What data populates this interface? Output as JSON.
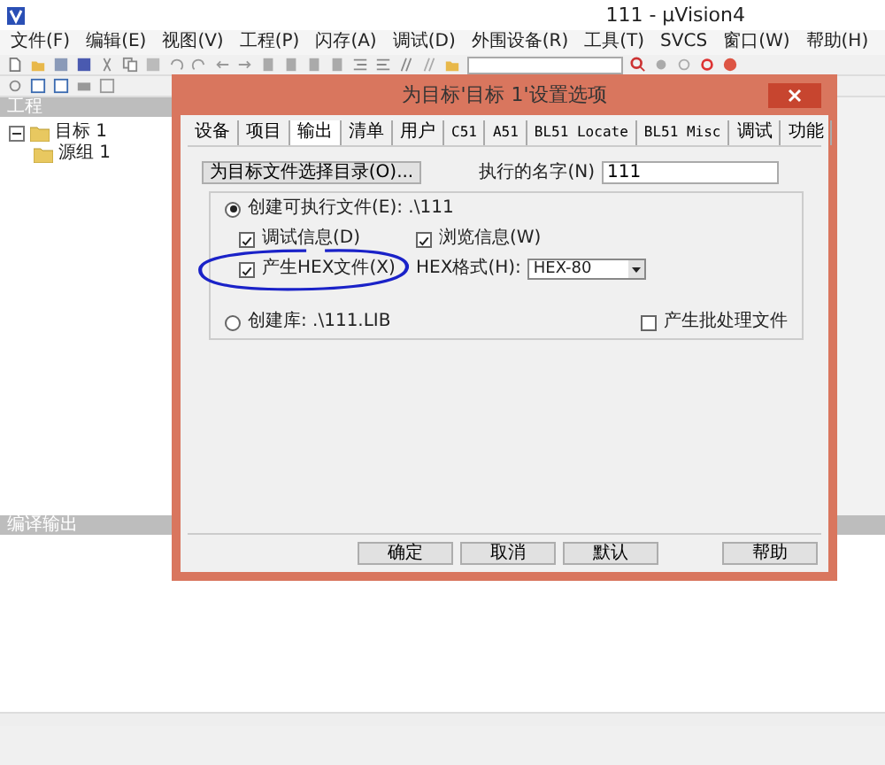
{
  "window": {
    "title": "111  - μVision4"
  },
  "menu": [
    "文件(F)",
    "编辑(E)",
    "视图(V)",
    "工程(P)",
    "闪存(A)",
    "调试(D)",
    "外围设备(R)",
    "工具(T)",
    "SVCS",
    "窗口(W)",
    "帮助(H)"
  ],
  "project_panel": {
    "title": "工程",
    "tree": [
      {
        "label": "目标 1",
        "expanded": true,
        "children": [
          {
            "label": "源组 1"
          }
        ]
      }
    ]
  },
  "output_panel": {
    "title": "编译输出"
  },
  "dialog": {
    "title": "为目标'目标 1'设置选项",
    "tabs": [
      {
        "label": "设备",
        "selected": false
      },
      {
        "label": "项目",
        "selected": false
      },
      {
        "label": "输出",
        "selected": true
      },
      {
        "label": "清单",
        "selected": false
      },
      {
        "label": "用户",
        "selected": false
      },
      {
        "label": "C51",
        "selected": false
      },
      {
        "label": "A51",
        "selected": false
      },
      {
        "label": "BL51 Locate",
        "selected": false
      },
      {
        "label": "BL51 Misc",
        "selected": false
      },
      {
        "label": "调试",
        "selected": false
      },
      {
        "label": "功能",
        "selected": false
      }
    ],
    "output_dir_button": "为目标文件选择目录(O)...",
    "name_label": "执行的名字(N)",
    "name_value": "111",
    "create_executable": {
      "label": "创建可执行文件(E): .\\111",
      "selected": true
    },
    "options": [
      {
        "label": "调试信息(D)",
        "checked": true
      },
      {
        "label": "浏览信息(W)",
        "checked": true
      },
      {
        "label": "产生HEX文件(X)",
        "checked": true
      }
    ],
    "hex_format": {
      "label": "HEX格式(H):",
      "value": "HEX-80"
    },
    "create_library": {
      "label": "创建库: .\\111.LIB",
      "selected": false
    },
    "batch_file": {
      "label": "产生批处理文件",
      "checked": false
    },
    "buttons": [
      "确定",
      "取消",
      "默认",
      "帮助"
    ]
  }
}
